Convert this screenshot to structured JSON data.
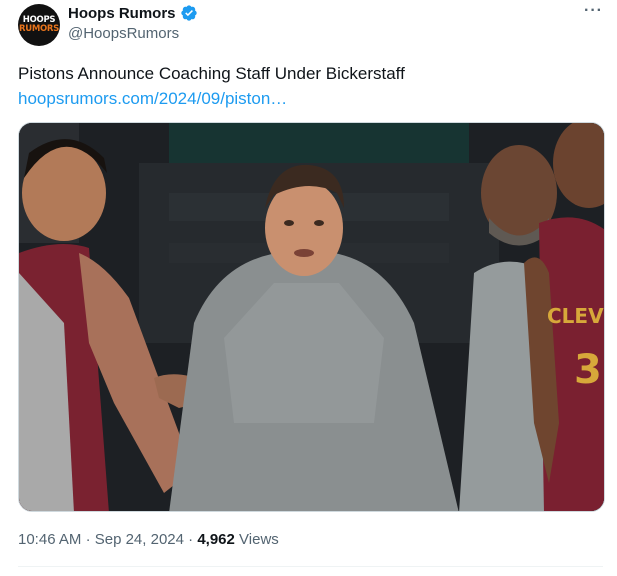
{
  "author": {
    "name": "Hoops Rumors",
    "handle": "@HoopsRumors",
    "avatar_text_top": "HOOPS",
    "avatar_text_bottom": "RUMORS",
    "verified_icon": "verified-badge-icon"
  },
  "more_label": "···",
  "tweet": {
    "text": "Pistons Announce Coaching Staff Under Bickerstaff",
    "link": "hoopsrumors.com/2024/09/piston…"
  },
  "media": {
    "jersey_text": "CLEVE",
    "jersey_number": "3"
  },
  "meta": {
    "time": "10:46 AM",
    "separator": "·",
    "date": "Sep 24, 2024",
    "views_count": "4,962",
    "views_label": "Views"
  },
  "colors": {
    "link": "#1d9bf0",
    "secondary_text": "#536471",
    "verified": "#1d9bf0",
    "avatar_accent": "#e8741c"
  }
}
